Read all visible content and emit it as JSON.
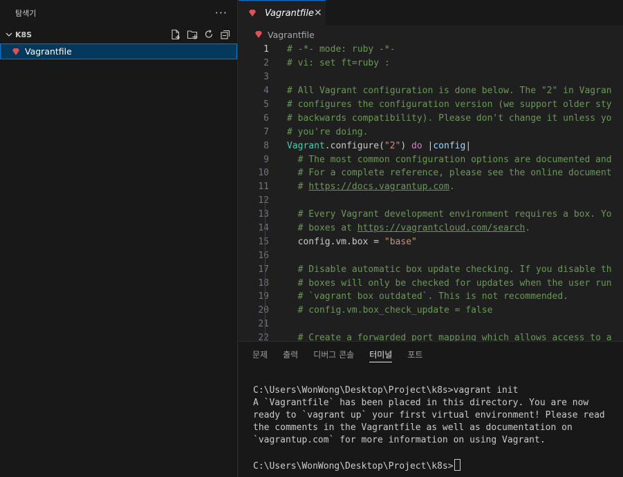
{
  "sidebar": {
    "title": "탐색기",
    "section": "K8S",
    "files": [
      "Vagrantfile"
    ]
  },
  "editor": {
    "tab_label": "Vagrantfile",
    "breadcrumb": "Vagrantfile",
    "active_line": 1,
    "lines": [
      {
        "n": 1,
        "tokens": [
          {
            "t": "# -*- mode: ruby -*-",
            "c": "comment"
          }
        ]
      },
      {
        "n": 2,
        "tokens": [
          {
            "t": "# vi: set ft=ruby :",
            "c": "comment"
          }
        ]
      },
      {
        "n": 3,
        "tokens": []
      },
      {
        "n": 4,
        "tokens": [
          {
            "t": "# All Vagrant configuration is done below. The \"2\" in Vagran",
            "c": "comment"
          }
        ]
      },
      {
        "n": 5,
        "tokens": [
          {
            "t": "# configures the configuration version (we support older sty",
            "c": "comment"
          }
        ]
      },
      {
        "n": 6,
        "tokens": [
          {
            "t": "# backwards compatibility). Please don't change it unless yo",
            "c": "comment"
          }
        ]
      },
      {
        "n": 7,
        "tokens": [
          {
            "t": "# you're doing.",
            "c": "comment"
          }
        ]
      },
      {
        "n": 8,
        "tokens": [
          {
            "t": "Vagrant",
            "c": "class"
          },
          {
            "t": ".configure(",
            "c": "plain"
          },
          {
            "t": "\"2\"",
            "c": "str"
          },
          {
            "t": ") ",
            "c": "plain"
          },
          {
            "t": "do",
            "c": "kw"
          },
          {
            "t": " |",
            "c": "plain"
          },
          {
            "t": "config",
            "c": "var"
          },
          {
            "t": "|",
            "c": "plain"
          }
        ]
      },
      {
        "n": 9,
        "tokens": [
          {
            "t": "  # The most common configuration options are documented and",
            "c": "comment"
          }
        ]
      },
      {
        "n": 10,
        "tokens": [
          {
            "t": "  # For a complete reference, please see the online document",
            "c": "comment"
          }
        ]
      },
      {
        "n": 11,
        "tokens": [
          {
            "t": "  # ",
            "c": "comment"
          },
          {
            "t": "https://docs.vagrantup.com",
            "c": "link"
          },
          {
            "t": ".",
            "c": "comment"
          }
        ]
      },
      {
        "n": 12,
        "tokens": []
      },
      {
        "n": 13,
        "tokens": [
          {
            "t": "  # Every Vagrant development environment requires a box. Yo",
            "c": "comment"
          }
        ]
      },
      {
        "n": 14,
        "tokens": [
          {
            "t": "  # boxes at ",
            "c": "comment"
          },
          {
            "t": "https://vagrantcloud.com/search",
            "c": "link"
          },
          {
            "t": ".",
            "c": "comment"
          }
        ]
      },
      {
        "n": 15,
        "tokens": [
          {
            "t": "  config.vm.box = ",
            "c": "plain"
          },
          {
            "t": "\"base\"",
            "c": "str"
          }
        ]
      },
      {
        "n": 16,
        "tokens": []
      },
      {
        "n": 17,
        "tokens": [
          {
            "t": "  # Disable automatic box update checking. If you disable th",
            "c": "comment"
          }
        ]
      },
      {
        "n": 18,
        "tokens": [
          {
            "t": "  # boxes will only be checked for updates when the user run",
            "c": "comment"
          }
        ]
      },
      {
        "n": 19,
        "tokens": [
          {
            "t": "  # `vagrant box outdated`. This is not recommended.",
            "c": "comment"
          }
        ]
      },
      {
        "n": 20,
        "tokens": [
          {
            "t": "  # config.vm.box_check_update = false",
            "c": "comment"
          }
        ]
      },
      {
        "n": 21,
        "tokens": []
      },
      {
        "n": 22,
        "tokens": [
          {
            "t": "  # Create a forwarded port mapping which allows access to a",
            "c": "comment"
          }
        ]
      }
    ]
  },
  "panel": {
    "tabs": [
      "문제",
      "출력",
      "디버그 콘솔",
      "터미널",
      "포트"
    ],
    "active_tab": "터미널",
    "terminal_lines": [
      "C:\\Users\\WonWong\\Desktop\\Project\\k8s>vagrant init",
      "A `Vagrantfile` has been placed in this directory. You are now",
      "ready to `vagrant up` your first virtual environment! Please read",
      "the comments in the Vagrantfile as well as documentation on",
      "`vagrantup.com` for more information on using Vagrant.",
      ""
    ],
    "prompt": "C:\\Users\\WonWong\\Desktop\\Project\\k8s>"
  },
  "colors": {
    "accent": "#0078d4",
    "ruby_icon": "#e05252",
    "comment": "#6a9955",
    "string": "#ce9178",
    "keyword": "#c586c0",
    "class": "#4ec9b0"
  },
  "icons": [
    "more-icon",
    "chevron-down-icon",
    "new-file-icon",
    "new-folder-icon",
    "refresh-icon",
    "collapse-all-icon",
    "ruby-file-icon",
    "close-icon"
  ]
}
